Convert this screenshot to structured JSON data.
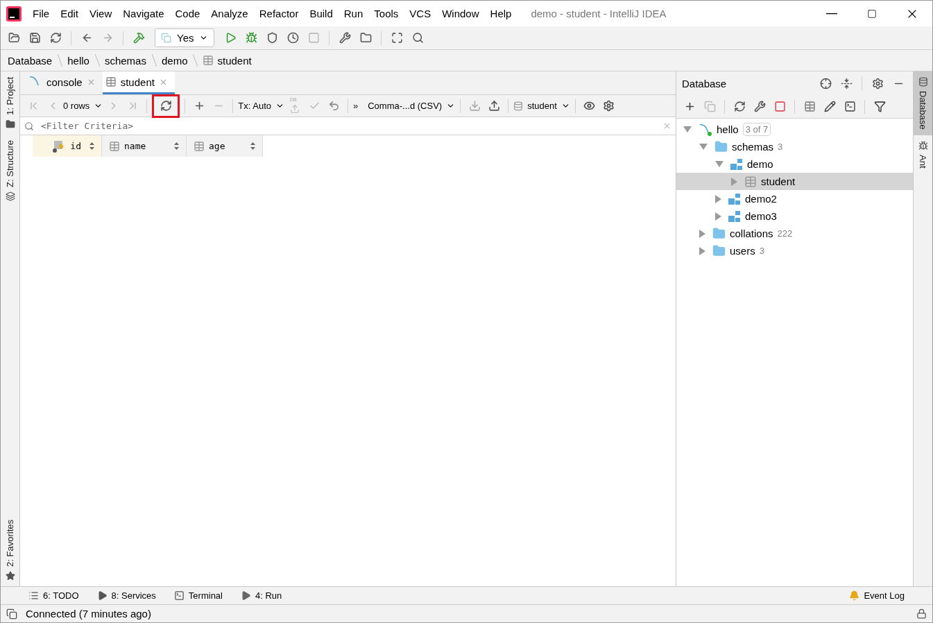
{
  "window": {
    "title": "demo - student - IntelliJ IDEA"
  },
  "menu": [
    "File",
    "Edit",
    "View",
    "Navigate",
    "Code",
    "Analyze",
    "Refactor",
    "Build",
    "Run",
    "Tools",
    "VCS",
    "Window",
    "Help"
  ],
  "main_toolbar": {
    "run_config": "Yes"
  },
  "breadcrumbs": [
    {
      "label": "Database",
      "kind": "plain"
    },
    {
      "label": "hello",
      "kind": "plain"
    },
    {
      "label": "schemas",
      "kind": "plain"
    },
    {
      "label": "demo",
      "kind": "plain"
    },
    {
      "label": "student",
      "kind": "table"
    }
  ],
  "left_stripe": {
    "top": [
      {
        "label": "1: Project",
        "kind": "folder"
      },
      {
        "label": "Z: Structure",
        "kind": "structure"
      }
    ],
    "bottom": [
      {
        "label": "2: Favorites",
        "kind": "star"
      }
    ]
  },
  "editor_tabs": [
    {
      "label": "console",
      "kind": "console",
      "selected": false
    },
    {
      "label": "student",
      "kind": "table",
      "selected": true
    }
  ],
  "grid_toolbar": {
    "rows": "0 rows",
    "refresh_highlighted": true,
    "tx": "Tx: Auto",
    "db_badge": "DB",
    "more": "»",
    "format": "Comma-...d (CSV)",
    "datasource": "student"
  },
  "filter": {
    "placeholder": "<Filter Criteria>"
  },
  "columns": [
    {
      "name": "id",
      "kind": "key"
    },
    {
      "name": "name",
      "kind": "plain"
    },
    {
      "name": "age",
      "kind": "plain"
    }
  ],
  "database_panel": {
    "title": "Database",
    "tree": [
      {
        "label": "hello",
        "kind": "connection",
        "badge": "3 of 7",
        "expanded": true,
        "selected": false,
        "children": [
          {
            "label": "schemas",
            "kind": "folder",
            "count": "3",
            "expanded": true,
            "selected": false,
            "children": [
              {
                "label": "demo",
                "kind": "schema",
                "expanded": true,
                "selected": false,
                "children": [
                  {
                    "label": "student",
                    "kind": "table",
                    "expanded": false,
                    "selected": true
                  }
                ]
              },
              {
                "label": "demo2",
                "kind": "schema",
                "expanded": false,
                "selected": false
              },
              {
                "label": "demo3",
                "kind": "schema",
                "expanded": false,
                "selected": false
              }
            ]
          },
          {
            "label": "collations",
            "kind": "folder",
            "count": "222",
            "expanded": false,
            "selected": false
          },
          {
            "label": "users",
            "kind": "folder",
            "count": "3",
            "expanded": false,
            "selected": false
          }
        ]
      }
    ]
  },
  "right_stripe": [
    {
      "label": "Database",
      "kind": "database",
      "selected": true
    },
    {
      "label": "Ant",
      "kind": "ant",
      "selected": false
    }
  ],
  "bottom_tools": [
    {
      "label": "6: TODO",
      "kind": "todo"
    },
    {
      "label": "8: Services",
      "kind": "services"
    },
    {
      "label": "Terminal",
      "kind": "terminal"
    },
    {
      "label": "4: Run",
      "kind": "run"
    }
  ],
  "event_log": "Event Log",
  "status": "Connected (7 minutes ago)"
}
